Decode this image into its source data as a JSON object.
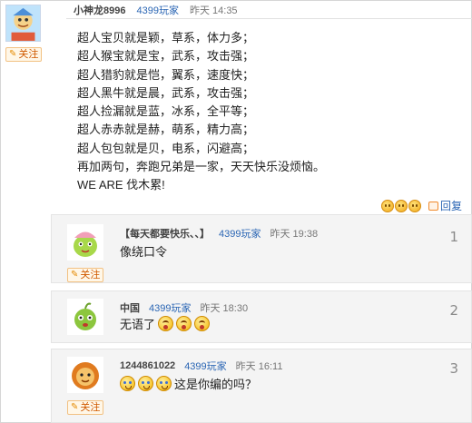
{
  "main_post": {
    "username": "小神龙8996",
    "site_tag": "4399玩家",
    "time": "昨天 14:35",
    "follow_label": "关注",
    "lines": [
      "超人宝贝就是颖，草系，体力多；",
      "超人猴宝就是宝，武系，攻击强；",
      "超人猎豹就是恺，翼系，速度快；",
      "超人黑牛就是晨，武系，攻击强；",
      "超人捡漏就是蓝，冰系，全平等；",
      "超人赤赤就是赫，萌系，精力高；",
      "超人包包就是贝，电系，闪避高；",
      "再加两句，奔跑兄弟是一家，天天快乐没烦恼。",
      "WE ARE 伐木累!"
    ],
    "reply_label": "回复"
  },
  "replies": [
    {
      "username": "【每天都要快乐、、】",
      "site_tag": "4399玩家",
      "time": "昨天 19:38",
      "follow_label": "关注",
      "text": "像绕口令",
      "floor": "1"
    },
    {
      "username": "中国",
      "site_tag": "4399玩家",
      "time": "昨天 18:30",
      "text": "无语了",
      "floor": "2"
    },
    {
      "username": "1244861022",
      "site_tag": "4399玩家",
      "time": "昨天 16:11",
      "follow_label": "关注",
      "text": "这是你编的吗？",
      "floor": "3"
    }
  ],
  "icons": {
    "follow": "pencil-icon",
    "reply": "reply-icon",
    "rating": "smiley-face-icon",
    "emoji_shock": "shocked-emoji-icon",
    "emoji_cry": "crying-emoji-icon"
  },
  "colors": {
    "link_blue": "#2b66b4",
    "follow_orange": "#d05a00",
    "reply_bg": "#f4f4f4"
  }
}
